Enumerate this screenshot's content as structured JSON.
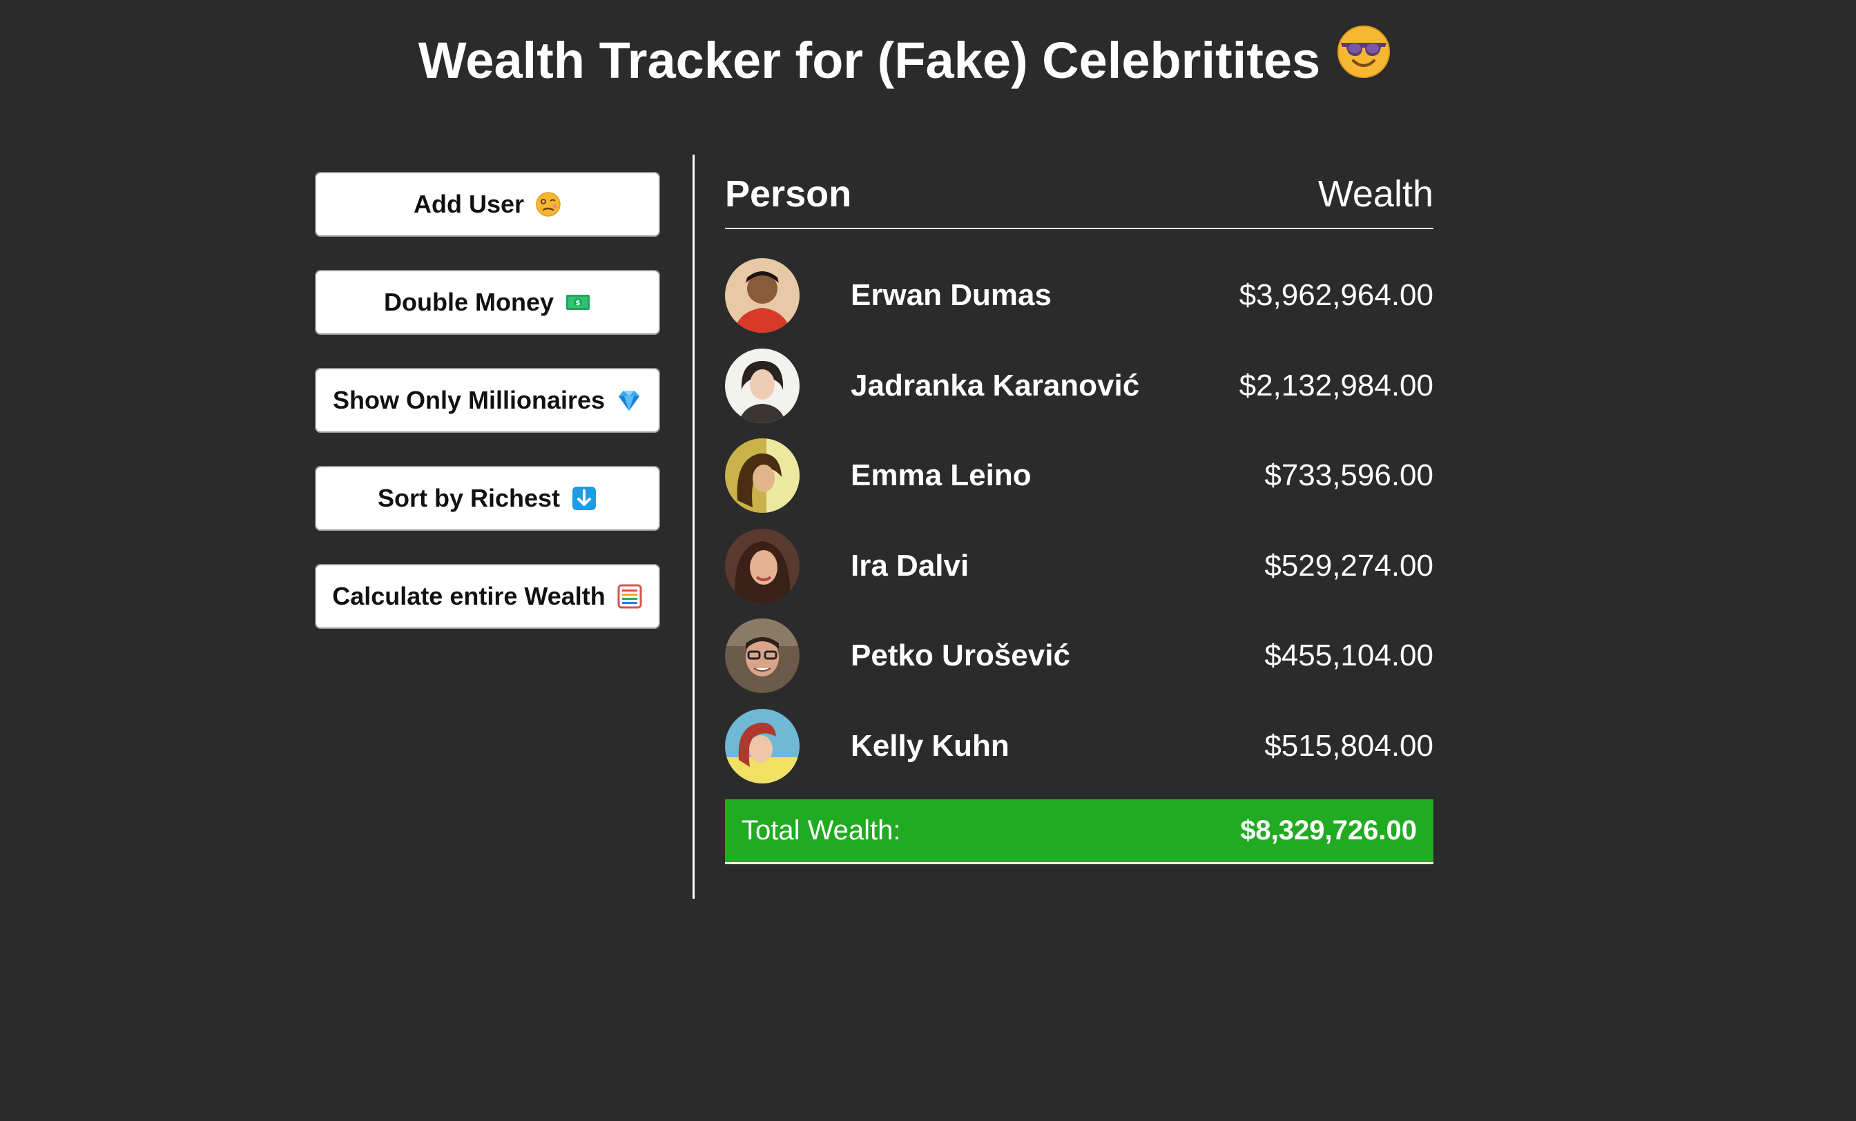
{
  "page": {
    "title": "Wealth Tracker for (Fake) Celebritites",
    "title_emoji_icon": "smiling-face-with-sunglasses-icon"
  },
  "sidebar": {
    "buttons": [
      {
        "label": "Add User",
        "icon": "woozy-face-icon"
      },
      {
        "label": "Double Money",
        "icon": "dollar-banknote-icon"
      },
      {
        "label": "Show Only Millionaires",
        "icon": "gem-stone-icon"
      },
      {
        "label": "Sort by Richest",
        "icon": "down-arrow-icon"
      },
      {
        "label": "Calculate entire Wealth",
        "icon": "abacus-icon"
      }
    ]
  },
  "table": {
    "header": {
      "person": "Person",
      "wealth": "Wealth"
    },
    "rows": [
      {
        "name": "Erwan Dumas",
        "wealth": "$3,962,964.00"
      },
      {
        "name": "Jadranka Karanović",
        "wealth": "$2,132,984.00"
      },
      {
        "name": "Emma Leino",
        "wealth": "$733,596.00"
      },
      {
        "name": "Ira Dalvi",
        "wealth": "$529,274.00"
      },
      {
        "name": "Petko Urošević",
        "wealth": "$455,104.00"
      },
      {
        "name": "Kelly Kuhn",
        "wealth": "$515,804.00"
      }
    ],
    "total": {
      "label": "Total Wealth:",
      "value": "$8,329,726.00"
    }
  },
  "colors": {
    "background": "#2b2b2b",
    "total_bar": "#21ab23",
    "button_bg": "#ffffff"
  }
}
